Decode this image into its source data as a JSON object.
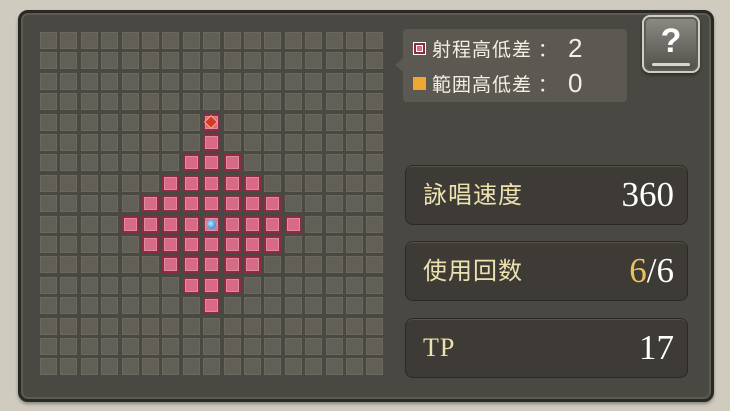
{
  "legend": {
    "range_height_label": "射程高低差",
    "range_height_value": "2",
    "area_height_label": "範囲高低差",
    "area_height_value": "0",
    "separator": "："
  },
  "help_button": {
    "label": "?"
  },
  "stats": {
    "cast_speed": {
      "label": "詠唱速度",
      "value": "360"
    },
    "uses": {
      "label": "使用回数",
      "current": "6",
      "separator": "/",
      "max": "6"
    },
    "tp": {
      "label": "TP",
      "value": "17"
    }
  },
  "colors": {
    "range_cell": "#d86a86",
    "area_cell": "#f0a731",
    "label_gold": "#ece2b0",
    "value_gold": "#e9c25a"
  },
  "grid": {
    "columns": 17,
    "rows": 17,
    "origin": [
      8,
      9
    ],
    "target": [
      8,
      4
    ],
    "range_radius": 4
  }
}
